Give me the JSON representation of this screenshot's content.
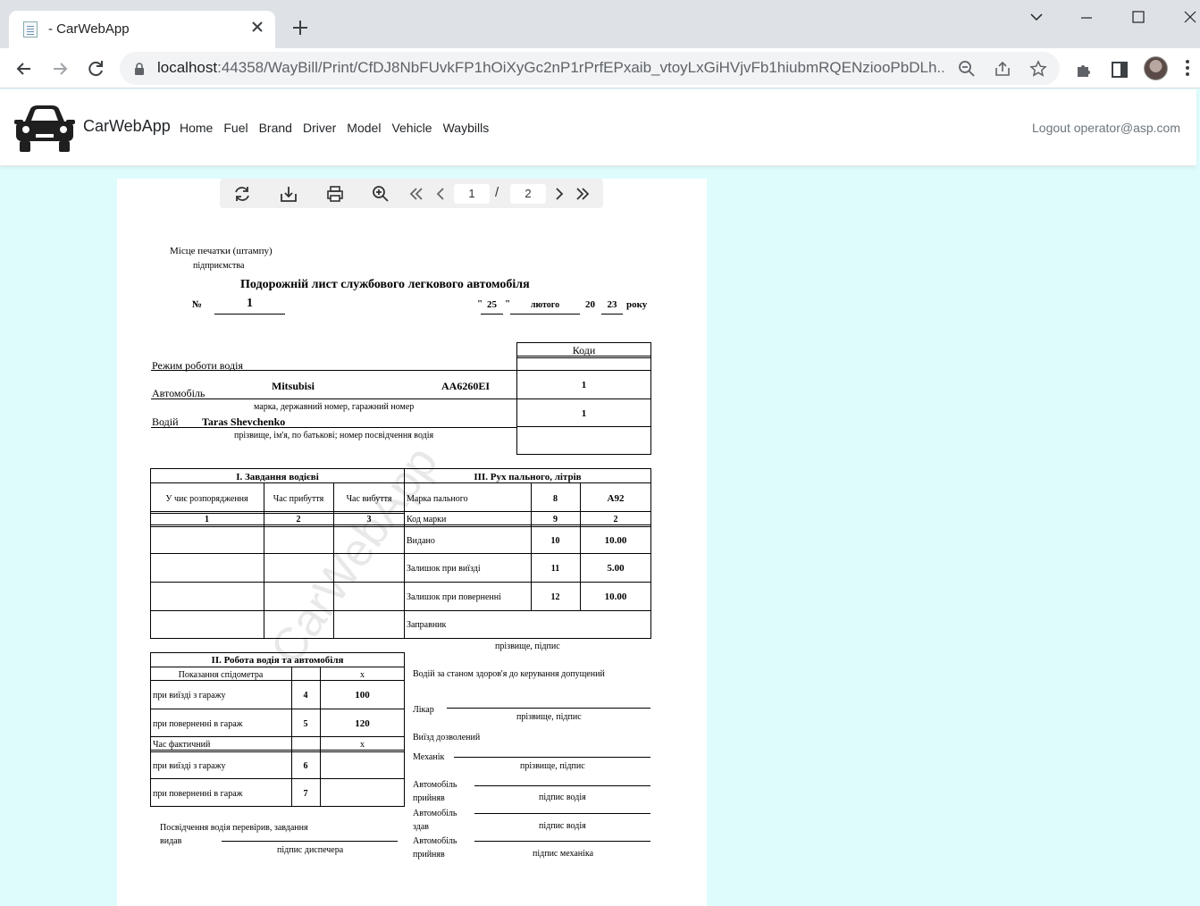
{
  "browser": {
    "tab_title": "- CarWebApp",
    "url_host": "localhost",
    "url_rest": ":44358/WayBill/Print/CfDJ8NbFUvkFP1hOiXyGc2nP1rPrfEPxaib_vtoyLxGiHVjvFb1hiubmRQENziooPbDLh..."
  },
  "site": {
    "brand": "CarWebApp",
    "nav": [
      "Home",
      "Fuel",
      "Brand",
      "Driver",
      "Model",
      "Vehicle",
      "Waybills"
    ],
    "logout": "Logout operator@asp.com"
  },
  "viewer": {
    "current_page": "1",
    "separator": "/",
    "total_pages": "2"
  },
  "doc": {
    "watermark": "CarWebApp",
    "stamp_line1": "Місце печатки (штампу)",
    "stamp_line2": "підприємства",
    "title": "Подорожній лист службового легкового автомобіля",
    "number_label": "№",
    "number": "1",
    "quote_open": "\"",
    "day": "25",
    "quote_close": "\"",
    "month": "лютого",
    "year_prefix": "20",
    "year_suffix": "23",
    "year_word": "року",
    "codes_header": "Коди",
    "driver_mode_label": "Режим роботи водія",
    "car_label": "Автомобіль",
    "car_brand": "Mitsubisi",
    "car_plate": "АА6260ЕІ",
    "car_code": "1",
    "car_caption": "марка, державний номер, гаражний номер",
    "driver_label": "Водій",
    "driver_name": "Taras Shevchenko",
    "driver_code": "1",
    "driver_caption": "прізвище, ім'я, по батькові; номер посвідчення водія",
    "task": {
      "title": "І. Завдання водієві",
      "col1": "У чиє розпорядження",
      "col2": "Час прибуття",
      "col3": "Час вибуття",
      "n1": "1",
      "n2": "2",
      "n3": "3"
    },
    "fuel": {
      "title": "ІІІ. Рух пального, літрів",
      "rows": [
        {
          "label": "Марка пального",
          "code": "8",
          "value": "A92"
        },
        {
          "label": "Код марки",
          "code": "9",
          "value": "2"
        },
        {
          "label": "Видано",
          "code": "10",
          "value": "10.00"
        },
        {
          "label": "Залишок при виїзді",
          "code": "11",
          "value": "5.00"
        },
        {
          "label": "Залишок при поверненні",
          "code": "12",
          "value": "10.00"
        },
        {
          "label": "Заправник",
          "code": "",
          "value": ""
        }
      ],
      "sign_caption": "прізвище, підпис"
    },
    "work": {
      "title": "ІІ. Робота водія та автомобіля",
      "odometer": "Показання спідометра",
      "x1": "х",
      "rows": [
        {
          "label": "при виїзді з гаражу",
          "code": "4",
          "value": "100"
        },
        {
          "label": "при поверненні в гараж",
          "code": "5",
          "value": "120"
        }
      ],
      "actual_time": "Час фактичний",
      "x2": "х",
      "rows2": [
        {
          "label": "при виїзді з гаражу",
          "code": "6"
        },
        {
          "label": "при поверненні в гараж",
          "code": "7"
        }
      ]
    },
    "health": "Водій за станом здоров'я до керування допущений",
    "doctor": "Лікар",
    "sign1": "прізвище, підпис",
    "exit_allowed": "Виїзд дозволений",
    "mechanic": "Механік",
    "sign2": "прізвище, підпис",
    "car_accepted1a": "Автомобіль",
    "car_accepted1b": "прийняв",
    "driver_sign1": "підпис водія",
    "car_handed_a": "Автомобіль",
    "car_handed_b": "здав",
    "driver_sign2": "підпис водія",
    "car_accepted2a": "Автомобіль",
    "car_accepted2b": "прийняв",
    "mechanic_sign": "підпис механіка",
    "dispatcher_text1": "Посвідчення водія перевірив, завдання",
    "dispatcher_text2": "видав",
    "dispatcher_sign": "підпис диспечера"
  }
}
